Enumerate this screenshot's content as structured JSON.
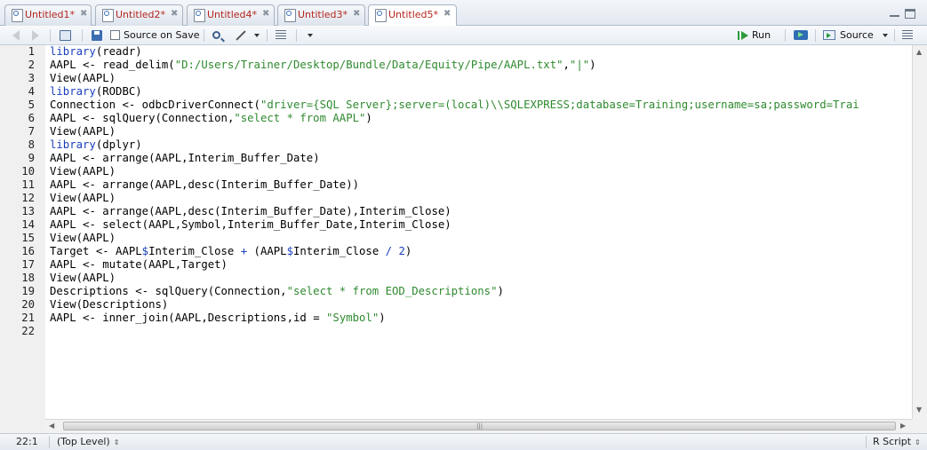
{
  "tabs": [
    {
      "label": "Untitled1*",
      "active": false
    },
    {
      "label": "Untitled2*",
      "active": false
    },
    {
      "label": "Untitled4*",
      "active": false
    },
    {
      "label": "Untitled3*",
      "active": false
    },
    {
      "label": "Untitled5*",
      "active": true
    }
  ],
  "toolbar": {
    "source_on_save_label": "Source on Save",
    "source_on_save_checked": false,
    "run_label": "Run",
    "source_label": "Source"
  },
  "editor": {
    "line_numbers": [
      "1",
      "2",
      "3",
      "4",
      "5",
      "6",
      "7",
      "8",
      "9",
      "10",
      "11",
      "12",
      "13",
      "14",
      "15",
      "16",
      "17",
      "18",
      "19",
      "20",
      "21",
      "22"
    ],
    "lines": [
      "library(readr)",
      "AAPL <- read_delim(\"D:/Users/Trainer/Desktop/Bundle/Data/Equity/Pipe/AAPL.txt\",\"|\")",
      "View(AAPL)",
      "library(RODBC)",
      "Connection <- odbcDriverConnect(\"driver={SQL Server};server=(local)\\\\SQLEXPRESS;database=Training;username=sa;password=Trai",
      "AAPL <- sqlQuery(Connection,\"select * from AAPL\")",
      "View(AAPL)",
      "library(dplyr)",
      "AAPL <- arrange(AAPL,Interim_Buffer_Date)",
      "View(AAPL)",
      "AAPL <- arrange(AAPL,desc(Interim_Buffer_Date))",
      "View(AAPL)",
      "AAPL <- arrange(AAPL,desc(Interim_Buffer_Date),Interim_Close)",
      "AAPL <- select(AAPL,Symbol,Interim_Buffer_Date,Interim_Close)",
      "View(AAPL)",
      "Target <- AAPL$Interim_Close + (AAPL$Interim_Close / 2)",
      "AAPL <- mutate(AAPL,Target)",
      "View(AAPL)",
      "Descriptions <- sqlQuery(Connection,\"select * from EOD_Descriptions\")",
      "View(Descriptions)",
      "AAPL <- inner_join(AAPL,Descriptions,id = \"Symbol\")",
      ""
    ]
  },
  "status": {
    "cursor_position": "22:1",
    "scope": "(Top Level)",
    "file_type": "R Script"
  },
  "colors": {
    "tab_label": "#b5271f",
    "keyword": "#1a3fbd",
    "string": "#2f8a2f",
    "run_green": "#2d9a3c"
  },
  "icons": [
    "r-file-icon",
    "close-icon",
    "back-arrow-icon",
    "forward-arrow-icon",
    "show-in-window-icon",
    "save-icon",
    "search-icon",
    "magic-wand-icon",
    "compile-report-icon",
    "menu-chevron-icon",
    "run-icon",
    "rerun-icon",
    "source-icon",
    "outline-icon",
    "minimize-icon",
    "maximize-icon"
  ]
}
